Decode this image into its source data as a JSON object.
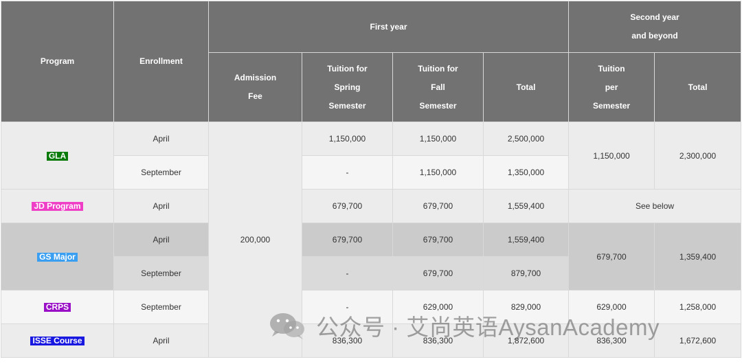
{
  "headers": {
    "program": "Program",
    "enrollment": "Enrollment",
    "first_year": "First year",
    "second_year": [
      "Second year",
      "and beyond"
    ],
    "admission_fee": [
      "Admission",
      "Fee"
    ],
    "tuition_spring": [
      "Tuition for",
      "Spring",
      "Semester"
    ],
    "tuition_fall": [
      "Tuition for",
      "Fall",
      "Semester"
    ],
    "total_first": "Total",
    "tuition_per_semester": [
      "Tuition",
      "per",
      "Semester"
    ],
    "total_second": "Total"
  },
  "admission_fee_value": "200,000",
  "programs": {
    "gla": {
      "label": "GLA",
      "color": "#0a7a0a"
    },
    "jd": {
      "label": "JD Program",
      "color": "#ee3fc6"
    },
    "gs": {
      "label": "GS Major",
      "color": "#3a9ff0"
    },
    "crps": {
      "label": "CRPS",
      "color": "#9a10c6"
    },
    "isse": {
      "label": "ISSE Course",
      "color": "#1818e0"
    }
  },
  "rows": {
    "gla_april": {
      "enrollment": "April",
      "spring": "1,150,000",
      "fall": "1,150,000",
      "total": "2,500,000"
    },
    "gla_september": {
      "enrollment": "September",
      "spring": "-",
      "fall": "1,150,000",
      "total": "1,350,000"
    },
    "gla_second": {
      "tuition": "1,150,000",
      "total": "2,300,000"
    },
    "jd_april": {
      "enrollment": "April",
      "spring": "679,700",
      "fall": "679,700",
      "total": "1,559,400",
      "second": "See below"
    },
    "gs_april": {
      "enrollment": "April",
      "spring": "679,700",
      "fall": "679,700",
      "total": "1,559,400"
    },
    "gs_september": {
      "enrollment": "September",
      "spring": "-",
      "fall": "679,700",
      "total": "879,700"
    },
    "gs_second": {
      "tuition": "679,700",
      "total": "1,359,400"
    },
    "crps_september": {
      "enrollment": "September",
      "spring": "-",
      "fall": "629,000",
      "total": "829,000",
      "second_tuition": "629,000",
      "second_total": "1,258,000"
    },
    "isse_april": {
      "enrollment": "April",
      "spring": "836,300",
      "fall": "836,300",
      "total": "1,872,600",
      "second_tuition": "836,300",
      "second_total": "1,672,600"
    }
  },
  "watermark": {
    "text": "公众号 · 艾尚英语AysanAcademy",
    "icon": "wechat-icon"
  }
}
